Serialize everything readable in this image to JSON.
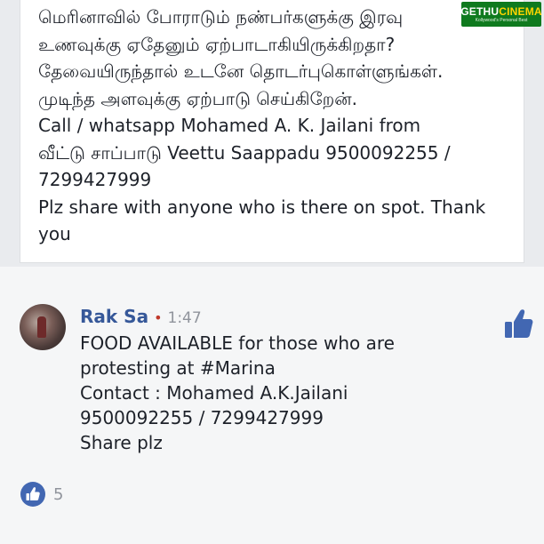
{
  "post": {
    "lines": [
      "மெரினாவில் போராடும் நண்பர்களுக்கு இரவு",
      "உணவுக்கு ஏதேனும் ஏற்பாடாகியிருக்கிறதா?",
      "தேவையிருந்தால் உடனே தொடர்புகொள்ளுங்கள்.",
      "முடிந்த அளவுக்கு ஏற்பாடு செய்கிறேன்.",
      "Call / whatsapp  Mohamed A. K. Jailani from",
      "வீட்டு சாப்பாடு Veettu Saappadu 9500092255 /",
      "7299427999",
      "Plz share with anyone who is there on spot. Thank you"
    ]
  },
  "watermark": {
    "part1": "GETHU",
    "part2": "CINEMA",
    "tagline": "Kollywood's Personal Best"
  },
  "comment": {
    "author": "Rak Sa",
    "separator": "•",
    "time": "1:47",
    "lines": [
      "FOOD AVAILABLE for those who are",
      "protesting at #Marina",
      "Contact : Mohamed A.K.Jailani",
      "9500092255 / 7299427999",
      "Share plz"
    ]
  },
  "reactions": {
    "count": "5"
  },
  "colors": {
    "facebook_blue": "#4267b2",
    "author_link": "#365899",
    "watermark_bg": "#0f7a1e",
    "background": "#e9ebee"
  },
  "icons": [
    "like-thumb-icon",
    "like-badge-icon"
  ]
}
